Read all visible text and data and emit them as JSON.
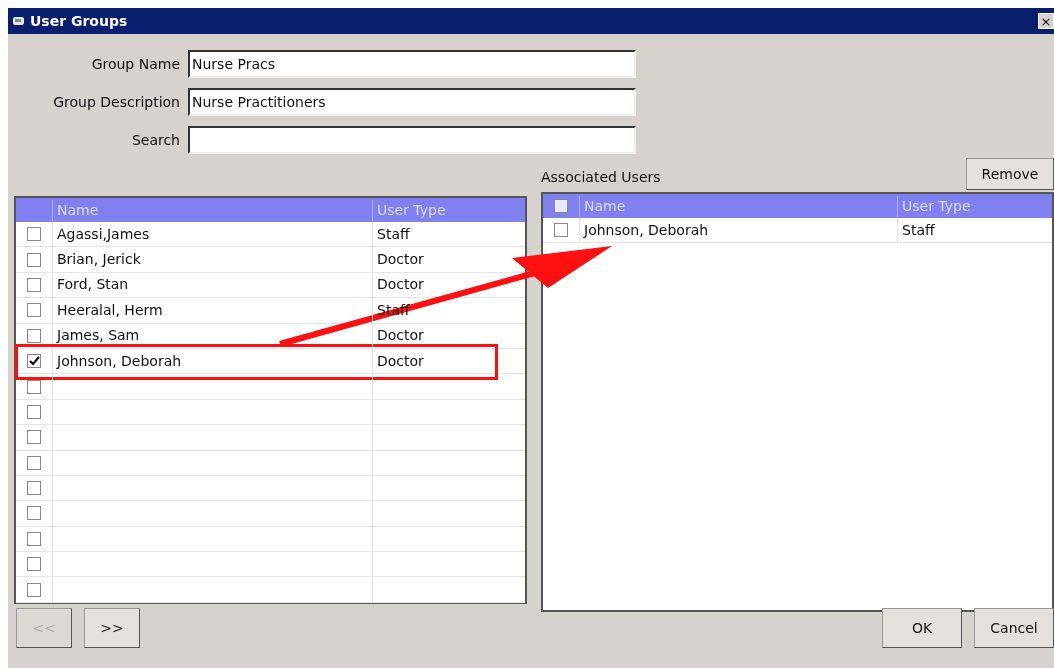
{
  "window": {
    "title": "User Groups",
    "close": "×"
  },
  "fields": [
    {
      "label": "Group Name",
      "value": "Nurse Pracs"
    },
    {
      "label": "Group Description",
      "value": "Nurse Practitioners"
    },
    {
      "label": "Search"
    }
  ],
  "remove_button": {
    "label": "Remove"
  },
  "available_users": {
    "columns": [
      "Name",
      "User Type"
    ],
    "rows": [
      {
        "name": "Agassi,James",
        "user_type": "Staff",
        "checked": false
      },
      {
        "name": "Brian, Jerick",
        "user_type": "Doctor",
        "checked": false
      },
      {
        "name": "Ford, Stan",
        "user_type": "Doctor",
        "checked": false
      },
      {
        "name": "Heeralal, Herm",
        "user_type": "Staff",
        "checked": false
      },
      {
        "name": "James, Sam",
        "user_type": "Doctor",
        "checked": false
      },
      {
        "name": "Johnson, Deborah",
        "user_type": "Doctor",
        "checked": true,
        "highlighted": true
      },
      {
        "checked": false
      },
      {
        "checked": false
      },
      {
        "checked": false
      },
      {
        "checked": false
      },
      {
        "checked": false
      },
      {
        "checked": false
      },
      {
        "checked": false
      },
      {
        "checked": false
      },
      {
        "checked": false
      }
    ]
  },
  "associated_users": {
    "title": "Associated Users",
    "header_checked": false,
    "columns": [
      "Name",
      "User Type"
    ],
    "rows": [
      {
        "name": "Johnson, Deborah",
        "user_type": "Staff",
        "checked": false
      }
    ]
  },
  "move_buttons": [
    {
      "label": "<<",
      "disabled": true
    },
    {
      "label": ">>",
      "disabled": false
    }
  ],
  "dialog_buttons": [
    {
      "label": "OK"
    },
    {
      "label": "Cancel"
    }
  ]
}
